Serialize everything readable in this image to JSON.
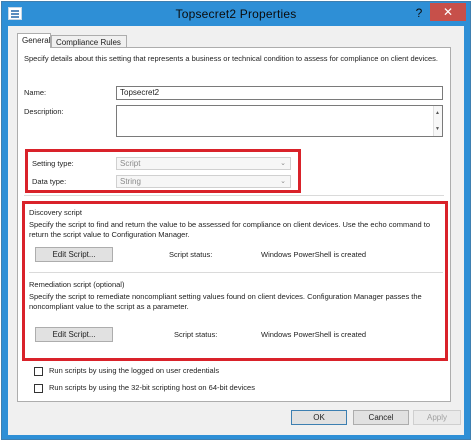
{
  "window": {
    "title": "Topsecret2 Properties",
    "help": "?",
    "close": "✕"
  },
  "tabs": [
    {
      "label": "General",
      "active": true
    },
    {
      "label": "Compliance Rules",
      "active": false
    }
  ],
  "general": {
    "intro": "Specify details about this setting that represents a business or technical condition to assess for compliance on client devices.",
    "name_label": "Name:",
    "name_value": "Topsecret2",
    "description_label": "Description:",
    "description_value": "",
    "setting_type_label": "Setting type:",
    "setting_type_value": "Script",
    "data_type_label": "Data type:",
    "data_type_value": "String"
  },
  "discovery": {
    "heading": "Discovery script",
    "description": "Specify the script to find and return the value to be assessed for compliance on client devices. Use the echo command to return the script value to Configuration Manager.",
    "edit_button": "Edit Script...",
    "status_label": "Script status:",
    "status_value": "Windows PowerShell is created"
  },
  "remediation": {
    "heading": "Remediation script (optional)",
    "description": "Specify the script to remediate noncompliant setting values found on client devices. Configuration Manager passes the noncompliant value to the script as a parameter.",
    "edit_button": "Edit Script...",
    "status_label": "Script status:",
    "status_value": "Windows PowerShell is created"
  },
  "options": [
    {
      "label": "Run scripts by using the logged on user credentials",
      "checked": false
    },
    {
      "label": "Run scripts by using the 32-bit scripting host on 64-bit devices",
      "checked": false
    }
  ],
  "footer": {
    "ok": "OK",
    "cancel": "Cancel",
    "apply": "Apply"
  },
  "colors": {
    "titlebar": "#2e8fd6",
    "highlight_box": "#d9222a",
    "close_button": "#c7504a"
  }
}
